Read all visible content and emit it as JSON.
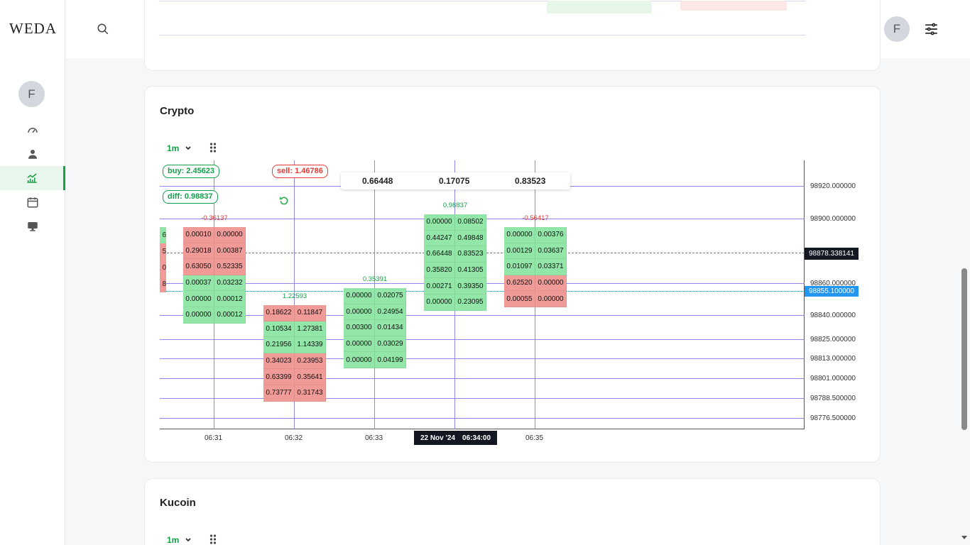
{
  "app": {
    "logo": "WEDA",
    "avatar_initial": "F"
  },
  "sidebar": {
    "items": [
      {
        "icon": "speedometer-icon"
      },
      {
        "icon": "user-icon"
      },
      {
        "icon": "chart-icon",
        "active": true
      },
      {
        "icon": "calendar-icon"
      },
      {
        "icon": "monitor-icon"
      }
    ]
  },
  "topbar": {
    "language_icon": "uk-flag-icon",
    "avatar_initial": "F"
  },
  "crypto": {
    "title": "Crypto",
    "timeframe": "1m",
    "buy_pill": "buy: 2.45623",
    "sell_pill": "sell: 1.46786",
    "diff_pill": "diff: 0.98837",
    "info": [
      "0.66448",
      "0.17075",
      "0.83523"
    ],
    "price_ticks": [
      "98920.000000",
      "98900.000000",
      "98860.000000",
      "98840.000000",
      "98825.000000",
      "98813.000000",
      "98801.000000",
      "98788.500000",
      "98776.500000"
    ],
    "price_tag_current": "98878.338141",
    "price_tag_last": "98855.100000",
    "time_ticks": [
      "06:31",
      "06:32",
      "06:33",
      "06:35"
    ],
    "crosshair_date": "22 Nov '24",
    "crosshair_time": "06:34:00",
    "edge_values": [
      "6",
      "5",
      "0",
      "8"
    ],
    "clusters": [
      {
        "label": "-0.36137",
        "rows": [
          [
            "0.00010",
            "0.00000"
          ],
          [
            "0.29018",
            "0.00387"
          ],
          [
            "0.63050",
            "0.52335"
          ],
          [
            "0.00037",
            "0.03232"
          ],
          [
            "0.00000",
            "0.00012"
          ],
          [
            "0.00000",
            "0.00012"
          ]
        ]
      },
      {
        "label": "1.22593",
        "rows": [
          [
            "0.18622",
            "0.11847"
          ],
          [
            "0.10534",
            "1.27381"
          ],
          [
            "0.21956",
            "1.14339"
          ],
          [
            "0.34023",
            "0.23953"
          ],
          [
            "0.63399",
            "0.35641"
          ],
          [
            "0.73777",
            "0.31743"
          ]
        ]
      },
      {
        "label": "0.35391",
        "rows": [
          [
            "0.00000",
            "0.02075"
          ],
          [
            "0.00000",
            "0.24954"
          ],
          [
            "0.00300",
            "0.01434"
          ],
          [
            "0.00000",
            "0.03029"
          ],
          [
            "0.00000",
            "0.04199"
          ]
        ]
      },
      {
        "label": "0.98837",
        "rows": [
          [
            "0.00000",
            "0.08502"
          ],
          [
            "0.44247",
            "0.49848"
          ],
          [
            "0.66448",
            "0.83523"
          ],
          [
            "0.35820",
            "0.41305"
          ],
          [
            "0.00271",
            "0.39350"
          ],
          [
            "0.00000",
            "0.23095"
          ]
        ]
      },
      {
        "label": "-0.56417",
        "rows": [
          [
            "0.00000",
            "0.00376"
          ],
          [
            "0.00129",
            "0.03637"
          ],
          [
            "0.01097",
            "0.03371"
          ],
          [
            "0.62520",
            "0.00000"
          ],
          [
            "0.00055",
            "0.00000"
          ]
        ]
      }
    ]
  },
  "kucoin": {
    "title": "Kucoin",
    "timeframe": "1m"
  }
}
